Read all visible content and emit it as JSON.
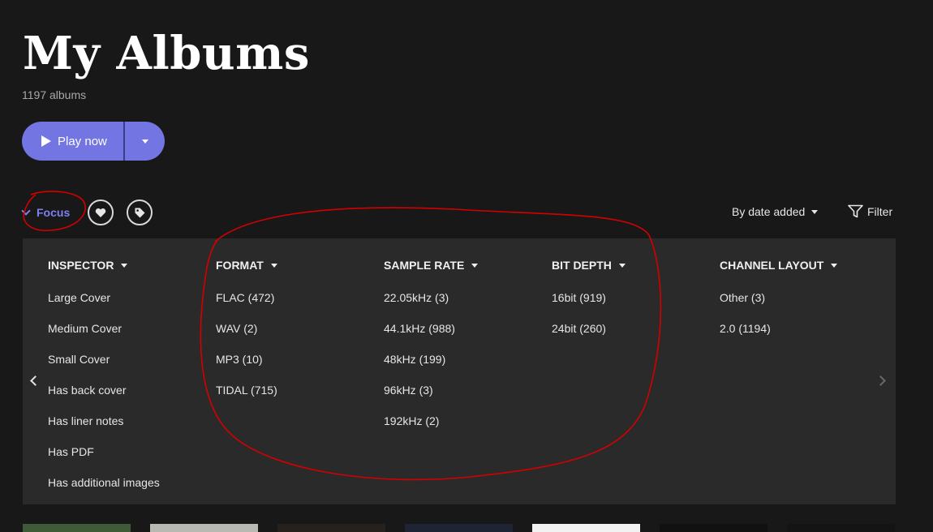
{
  "header": {
    "title": "My Albums",
    "count": "1197 albums"
  },
  "play": {
    "label": "Play now",
    "accent": "#7375e2"
  },
  "toolbar": {
    "focus_label": "Focus",
    "favorites_icon": "heart-icon",
    "tags_icon": "tag-icon",
    "sort_label": "By date added",
    "filter_label": "Filter",
    "focus_color": "#7f7ff0"
  },
  "focus_panel": {
    "columns": [
      {
        "heading": "INSPECTOR",
        "options": [
          "Large Cover",
          "Medium Cover",
          "Small Cover",
          "Has back cover",
          "Has liner notes",
          "Has PDF",
          "Has additional images"
        ]
      },
      {
        "heading": "FORMAT",
        "options": [
          "FLAC (472)",
          "WAV (2)",
          "MP3 (10)",
          "TIDAL (715)"
        ]
      },
      {
        "heading": "SAMPLE RATE",
        "options": [
          "22.05kHz (3)",
          "44.1kHz (988)",
          "48kHz (199)",
          "96kHz (3)",
          "192kHz (2)"
        ]
      },
      {
        "heading": "BIT DEPTH",
        "options": [
          "16bit (919)",
          "24bit (260)"
        ]
      },
      {
        "heading": "CHANNEL LAYOUT",
        "options": [
          "Other (3)",
          "2.0 (1194)"
        ]
      }
    ]
  },
  "annotation_color": "#d40000"
}
